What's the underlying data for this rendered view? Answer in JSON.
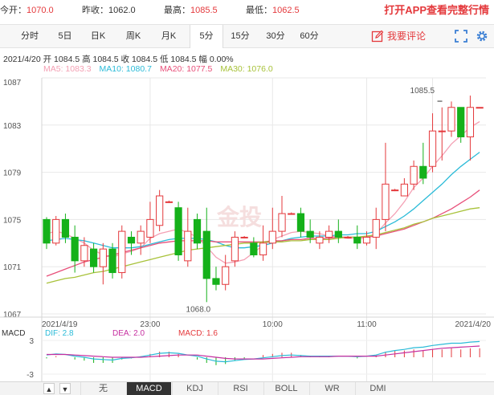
{
  "quote": {
    "open_label": "今开：",
    "open_value": "1070.0",
    "prev_close_label": "昨收：",
    "prev_close_value": "1062.0",
    "high_label": "最高：",
    "high_value": "1085.5",
    "low_label": "最低：",
    "low_value": "1062.5",
    "cta": "打开APP查看完整行情"
  },
  "tabs": [
    {
      "label": "分时",
      "active": false
    },
    {
      "label": "5日",
      "active": false
    },
    {
      "label": "日K",
      "active": false
    },
    {
      "label": "周K",
      "active": false
    },
    {
      "label": "月K",
      "active": false
    },
    {
      "label": "5分",
      "active": true
    },
    {
      "label": "15分",
      "active": false
    },
    {
      "label": "30分",
      "active": false
    },
    {
      "label": "60分",
      "active": false
    }
  ],
  "toolbar": {
    "comment_label": "我要评论"
  },
  "info": {
    "line": "2021/4/20  开 1084.5  高 1084.5  收 1084.5  低 1084.5  幅 0.00%"
  },
  "ma_legend": [
    {
      "text": "MA5: 1083.3",
      "color": "#f4a0b4"
    },
    {
      "text": "MA10: 1080.7",
      "color": "#2bbbd8"
    },
    {
      "text": "MA20: 1077.5",
      "color": "#e8507a"
    },
    {
      "text": "MA30: 1076.0",
      "color": "#a8c23a"
    }
  ],
  "watermark": "金投",
  "colors": {
    "up": "#e4393c",
    "down": "#15b11a",
    "macd_dif": "#2bbbd8",
    "macd_dea": "#c62fa0"
  },
  "chart_data": {
    "type": "candlestick",
    "price_axis": {
      "ylim": [
        1067,
        1087
      ],
      "ticks": [
        1087,
        1083,
        1079,
        1075,
        1071,
        1067
      ]
    },
    "time_labels": [
      {
        "index": 0,
        "label": "2021/4/19"
      },
      {
        "index": 11,
        "label": "23:00"
      },
      {
        "index": 24,
        "label": "10:00"
      },
      {
        "index": 34,
        "label": "11:00"
      },
      {
        "index": 41,
        "label": "2021/4/20"
      }
    ],
    "annotations": [
      {
        "index": 41,
        "value": 1085.5,
        "label": "1085.5",
        "kind": "high"
      },
      {
        "index": 16,
        "value": 1068.0,
        "label": "1068.0",
        "kind": "low"
      }
    ],
    "candles": [
      [
        1075,
        1073,
        1075.2,
        1072.5
      ],
      [
        1073,
        1075,
        1075.3,
        1072.8
      ],
      [
        1075,
        1073.5,
        1075.5,
        1073.0
      ],
      [
        1073.5,
        1071.5,
        1074.5,
        1070.5
      ],
      [
        1071.5,
        1072.8,
        1073.5,
        1071.0
      ],
      [
        1072.5,
        1071.0,
        1073.0,
        1070.5
      ],
      [
        1071.0,
        1072.5,
        1073.0,
        1069.5
      ],
      [
        1072.5,
        1070.5,
        1073.0,
        1070.0
      ],
      [
        1070.5,
        1074.0,
        1074.5,
        1070.0
      ],
      [
        1073.5,
        1073.0,
        1074.0,
        1072.0
      ],
      [
        1073.0,
        1074.0,
        1074.5,
        1072.0
      ],
      [
        1073.5,
        1075.0,
        1076.5,
        1073.0
      ],
      [
        1074.5,
        1077.0,
        1077.5,
        1074.0
      ],
      [
        1076.5,
        1076.5,
        1076.6,
        1076.4
      ],
      [
        1076.0,
        1072.0,
        1076.5,
        1071.5
      ],
      [
        1071.5,
        1074.0,
        1076.0,
        1071.0
      ],
      [
        1075.0,
        1073.0,
        1075.5,
        1072.5
      ],
      [
        1074.0,
        1070.0,
        1076.0,
        1068.0
      ],
      [
        1070.0,
        1069.5,
        1071.0,
        1069.0
      ],
      [
        1069.5,
        1071.0,
        1072.0,
        1069.0
      ],
      [
        1071.5,
        1073.5,
        1074.0,
        1071.0
      ],
      [
        1073.5,
        1073.5,
        1073.6,
        1073.4
      ],
      [
        1073.0,
        1072.0,
        1073.5,
        1071.8
      ],
      [
        1072.0,
        1073.0,
        1074.5,
        1071.5
      ],
      [
        1073.0,
        1074.0,
        1076.0,
        1072.5
      ],
      [
        1074.0,
        1075.5,
        1077.0,
        1073.5
      ],
      [
        1075.5,
        1075.5,
        1075.6,
        1075.4
      ],
      [
        1075.5,
        1074.0,
        1076.0,
        1073.5
      ],
      [
        1074.0,
        1073.5,
        1075.0,
        1073.0
      ],
      [
        1073.0,
        1073.5,
        1074.0,
        1072.5
      ],
      [
        1073.5,
        1074.0,
        1074.5,
        1073.0
      ],
      [
        1074.0,
        1073.5,
        1075.0,
        1073.0
      ],
      [
        1073.5,
        1073.5,
        1073.6,
        1073.4
      ],
      [
        1073.5,
        1073.0,
        1074.5,
        1072.5
      ],
      [
        1073.0,
        1073.5,
        1074.0,
        1072.8
      ],
      [
        1073.5,
        1075.0,
        1076.0,
        1072.5
      ],
      [
        1075.0,
        1078.0,
        1081.5,
        1074.0
      ],
      [
        1077.5,
        1077.5,
        1077.6,
        1077.4
      ],
      [
        1077.0,
        1078.0,
        1078.5,
        1077.0
      ],
      [
        1078.0,
        1079.5,
        1080.0,
        1077.5
      ],
      [
        1079.5,
        1078.5,
        1081.5,
        1078.0
      ],
      [
        1079.5,
        1082.5,
        1084.0,
        1079.0
      ],
      [
        1082.5,
        1082.5,
        1084.5,
        1080.0
      ],
      [
        1082.5,
        1084.5,
        1085.0,
        1082.0
      ],
      [
        1084.5,
        1082.0,
        1084.5,
        1081.5
      ],
      [
        1082.0,
        1084.5,
        1085.5,
        1080.0
      ],
      [
        1084.5,
        1084.5,
        1084.5,
        1084.5
      ]
    ],
    "ma_series": [
      {
        "name": "MA5",
        "color": "#f4a0b4",
        "values": [
          1073.8,
          1074.0,
          1073.8,
          1073.4,
          1073.0,
          1072.4,
          1072.0,
          1071.8,
          1072.1,
          1072.3,
          1072.6,
          1073.4,
          1073.8,
          1074.0,
          1074.2,
          1073.9,
          1073.5,
          1072.7,
          1071.8,
          1071.3,
          1071.4,
          1071.6,
          1072.2,
          1072.8,
          1073.3,
          1073.6,
          1073.9,
          1074.0,
          1073.9,
          1073.8,
          1073.6,
          1073.5,
          1073.4,
          1073.4,
          1073.4,
          1073.8,
          1074.7,
          1075.5,
          1076.5,
          1077.7,
          1078.5,
          1079.5,
          1080.4,
          1081.4,
          1082.1,
          1082.8,
          1083.3
        ]
      },
      {
        "name": "MA10",
        "color": "#2bbbd8",
        "values": [
          1073.2,
          1073.3,
          1073.4,
          1073.3,
          1073.2,
          1073.0,
          1072.8,
          1072.6,
          1072.6,
          1072.6,
          1072.7,
          1072.9,
          1073.1,
          1073.3,
          1073.4,
          1073.4,
          1073.4,
          1073.3,
          1073.1,
          1072.8,
          1072.6,
          1072.6,
          1072.7,
          1072.8,
          1073.0,
          1073.2,
          1073.4,
          1073.5,
          1073.6,
          1073.6,
          1073.6,
          1073.7,
          1073.7,
          1073.8,
          1073.8,
          1074.0,
          1074.4,
          1074.8,
          1075.3,
          1075.9,
          1076.6,
          1077.3,
          1078.0,
          1078.8,
          1079.5,
          1080.1,
          1080.7
        ]
      },
      {
        "name": "MA20",
        "color": "#e8507a",
        "values": [
          1070.2,
          1070.5,
          1070.8,
          1071.1,
          1071.4,
          1071.6,
          1071.8,
          1072.0,
          1072.2,
          1072.4,
          1072.6,
          1072.8,
          1073.0,
          1073.1,
          1073.2,
          1073.2,
          1073.2,
          1073.2,
          1073.1,
          1073.1,
          1073.1,
          1073.1,
          1073.1,
          1073.1,
          1073.2,
          1073.2,
          1073.3,
          1073.3,
          1073.4,
          1073.4,
          1073.4,
          1073.5,
          1073.5,
          1073.5,
          1073.5,
          1073.6,
          1073.8,
          1074.0,
          1074.2,
          1074.5,
          1074.8,
          1075.1,
          1075.5,
          1075.9,
          1076.4,
          1076.9,
          1077.5
        ]
      },
      {
        "name": "MA30",
        "color": "#a8c23a",
        "values": [
          1069.6,
          1069.8,
          1070.0,
          1070.1,
          1070.3,
          1070.5,
          1070.6,
          1070.8,
          1071.0,
          1071.2,
          1071.4,
          1071.6,
          1071.8,
          1072.0,
          1072.2,
          1072.4,
          1072.5,
          1072.6,
          1072.7,
          1072.8,
          1072.9,
          1073.0,
          1073.0,
          1073.1,
          1073.1,
          1073.1,
          1073.2,
          1073.2,
          1073.3,
          1073.3,
          1073.3,
          1073.4,
          1073.5,
          1073.5,
          1073.6,
          1073.7,
          1073.9,
          1074.1,
          1074.3,
          1074.6,
          1074.8,
          1075.1,
          1075.3,
          1075.5,
          1075.7,
          1075.9,
          1076.0
        ]
      }
    ],
    "macd": {
      "label": "MACD",
      "dif_label": "DIF: 2.8",
      "dea_label": "DEA: 2.0",
      "macd_label": "MACD: 1.6",
      "ylim": [
        -3,
        3
      ],
      "ticks": [
        3,
        -3
      ],
      "dif": [
        0.4,
        0.6,
        0.5,
        0.2,
        0.0,
        -0.3,
        -0.4,
        -0.5,
        -0.2,
        -0.1,
        0.1,
        0.4,
        0.7,
        0.8,
        0.7,
        0.4,
        0.2,
        -0.3,
        -0.7,
        -0.8,
        -0.6,
        -0.4,
        -0.3,
        -0.1,
        0.1,
        0.3,
        0.4,
        0.3,
        0.2,
        0.2,
        0.2,
        0.2,
        0.2,
        0.1,
        0.2,
        0.4,
        0.9,
        1.2,
        1.4,
        1.7,
        1.8,
        2.1,
        2.3,
        2.5,
        2.5,
        2.7,
        2.8
      ],
      "dea": [
        0.5,
        0.5,
        0.5,
        0.4,
        0.3,
        0.2,
        0.1,
        0.0,
        0.0,
        0.0,
        0.0,
        0.1,
        0.2,
        0.3,
        0.4,
        0.4,
        0.4,
        0.2,
        0.0,
        -0.2,
        -0.3,
        -0.3,
        -0.3,
        -0.3,
        -0.2,
        -0.1,
        0.0,
        0.1,
        0.1,
        0.1,
        0.1,
        0.2,
        0.2,
        0.2,
        0.2,
        0.2,
        0.4,
        0.6,
        0.8,
        1.0,
        1.2,
        1.4,
        1.6,
        1.7,
        1.8,
        1.9,
        2.0
      ],
      "hist": [
        -0.2,
        0.2,
        0.0,
        -0.4,
        -0.6,
        -1.0,
        -1.0,
        -1.0,
        -0.4,
        -0.2,
        0.2,
        0.6,
        1.0,
        1.0,
        0.6,
        0.0,
        -0.4,
        -1.0,
        -1.4,
        -1.2,
        -0.6,
        -0.2,
        0.0,
        0.4,
        0.6,
        0.8,
        0.8,
        0.4,
        0.2,
        0.2,
        0.2,
        0.0,
        0.0,
        -0.2,
        0.0,
        0.4,
        1.0,
        1.2,
        1.2,
        1.4,
        1.2,
        1.4,
        1.4,
        1.6,
        1.4,
        1.6,
        1.6
      ]
    }
  },
  "indicators": {
    "nav_up": "▲",
    "nav_down": "▼",
    "tabs": [
      {
        "label": "无",
        "active": false
      },
      {
        "label": "MACD",
        "active": true
      },
      {
        "label": "KDJ",
        "active": false
      },
      {
        "label": "RSI",
        "active": false
      },
      {
        "label": "BOLL",
        "active": false
      },
      {
        "label": "WR",
        "active": false
      },
      {
        "label": "DMI",
        "active": false
      }
    ]
  }
}
